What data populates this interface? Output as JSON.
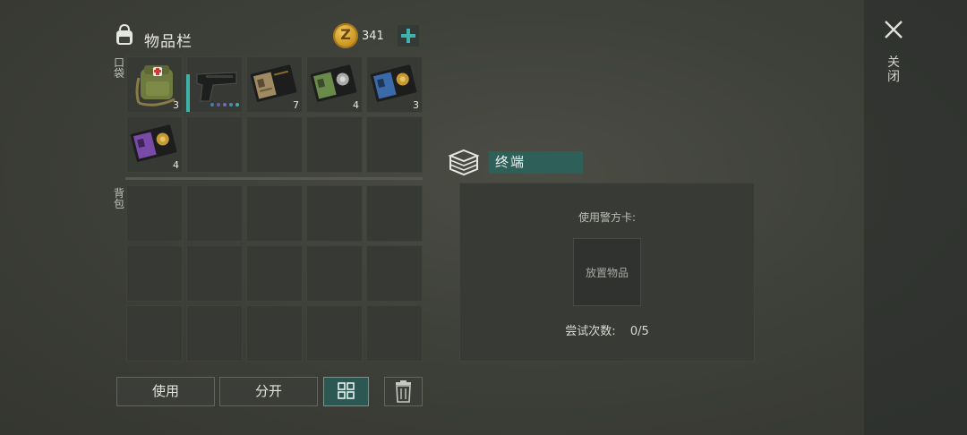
{
  "inventory": {
    "title": "物品栏",
    "coins": "341",
    "pocket_label": "口袋",
    "backpack_label": "背包",
    "pocket_slots": [
      {
        "item": "first-aid-bag",
        "qty": "3"
      },
      {
        "item": "pistol",
        "qty": ""
      },
      {
        "item": "id-card-wallet-tan",
        "qty": "7"
      },
      {
        "item": "id-card-wallet-green",
        "qty": "4"
      },
      {
        "item": "id-card-wallet-blue",
        "qty": "3"
      },
      {
        "item": "id-card-wallet-purple",
        "qty": "4"
      }
    ]
  },
  "buttons": {
    "use": "使用",
    "split": "分开"
  },
  "terminal": {
    "title": "终端",
    "use_card_label": "使用警方卡:",
    "drop_slot_label": "放置物品",
    "attempts_label": "尝试次数:",
    "attempts_value": "0/5"
  },
  "close_label": "关闭",
  "colors": {
    "accent": "#3fb3aa",
    "selected_bg": "#2f5f59",
    "coin": "#e0ab36"
  }
}
